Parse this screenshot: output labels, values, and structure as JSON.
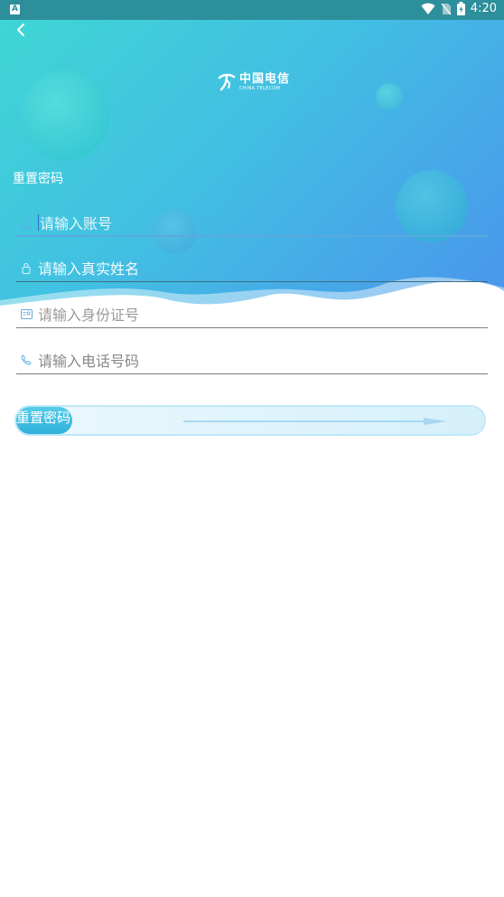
{
  "status_bar": {
    "badge": "A",
    "time": "4:20"
  },
  "header": {
    "logo_cn": "中国电信",
    "logo_en": "CHINA TELECOM",
    "title": "重置密码"
  },
  "form": {
    "account_placeholder": "请输入账号",
    "name_placeholder": "请输入真实姓名",
    "id_placeholder": "请输入身份证号",
    "phone_placeholder": "请输入电话号码"
  },
  "slider": {
    "label": "重置密码"
  },
  "colors": {
    "header_start": "#3ed7d3",
    "header_end": "#4a93ec",
    "accent": "#2fb1dc"
  },
  "icons": [
    "back-icon",
    "user-icon",
    "lock-icon",
    "id-card-icon",
    "phone-icon",
    "wifi-icon",
    "no-sim-icon",
    "battery-icon",
    "arrow-right-icon"
  ]
}
